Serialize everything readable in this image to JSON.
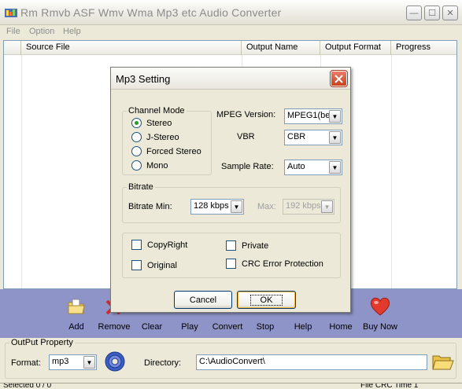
{
  "window": {
    "title": "Rm Rmvb ASF Wmv Wma Mp3 etc Audio Converter",
    "minimize_glyph": "—",
    "maximize_glyph": "☐",
    "close_glyph": "✕"
  },
  "menu": {
    "file": "File",
    "option": "Option",
    "help": "Help"
  },
  "file_list": {
    "columns": [
      "",
      "Source File",
      "Output Name",
      "Output Format",
      "Progress"
    ]
  },
  "toolbar": {
    "add": "Add",
    "remove": "Remove",
    "clear": "Clear",
    "play": "Play",
    "convert": "Convert",
    "stop": "Stop",
    "help": "Help",
    "home": "Home",
    "buy_now": "Buy Now"
  },
  "output_property": {
    "legend": "OutPut Property",
    "format_label": "Format:",
    "format_value": "mp3",
    "directory_label": "Directory:",
    "directory_value": "C:\\AudioConvert\\"
  },
  "status_bar": {
    "left": "Selected 0 / 0",
    "right": "File CRC Time 1"
  },
  "dialog": {
    "title": "Mp3 Setting",
    "channel_mode": {
      "legend": "Channel Mode",
      "options": [
        "Stereo",
        "J-Stereo",
        "Forced Stereo",
        "Mono"
      ],
      "selected": "Stereo"
    },
    "mpeg_version_label": "MPEG Version:",
    "mpeg_version_value": "MPEG1(be",
    "vbr_label": "VBR",
    "vbr_value": "CBR",
    "sample_rate_label": "Sample Rate:",
    "sample_rate_value": "Auto",
    "bitrate": {
      "legend": "Bitrate",
      "min_label": "Bitrate Min:",
      "min_value": "128 kbps",
      "max_label": "Max:",
      "max_value": "192 kbps"
    },
    "checkboxes": {
      "copyright": "CopyRight",
      "private": "Private",
      "original": "Original",
      "crc": "CRC Error Protection"
    },
    "cancel": "Cancel",
    "ok": "OK"
  },
  "colors": {
    "toolbar_bg": "#8e94c7",
    "dialog_close": "#c9401f",
    "window_bg": "#ece9d8"
  }
}
